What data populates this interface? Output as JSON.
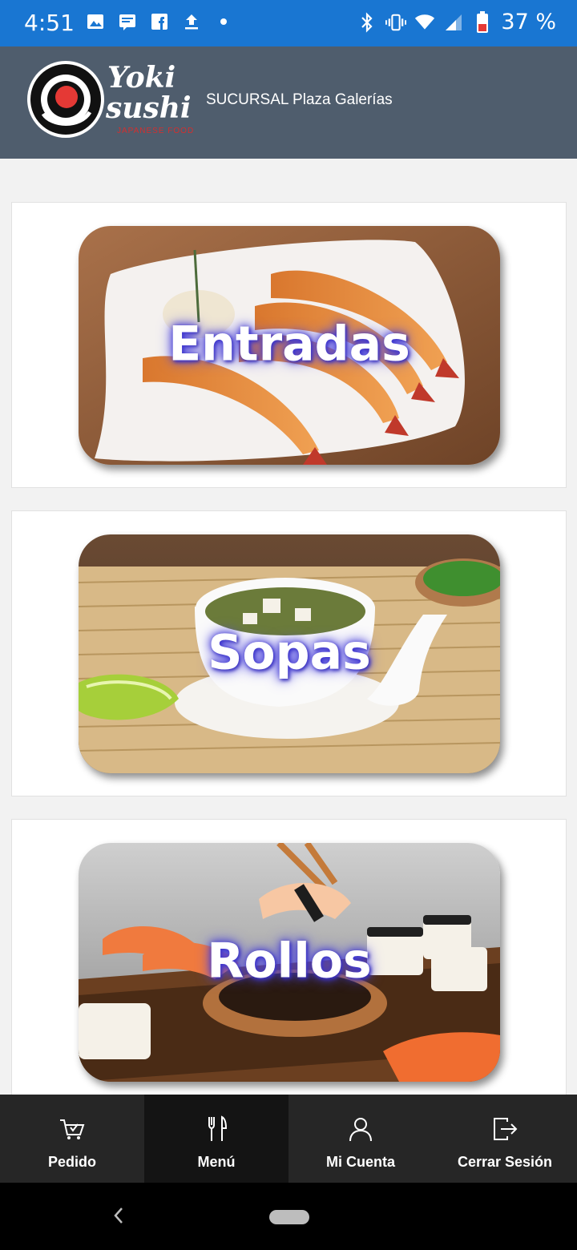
{
  "status_bar": {
    "time": "4:51",
    "battery": "37 %",
    "icons_left": [
      "image-icon",
      "message-icon",
      "facebook-icon",
      "upload-icon",
      "dot-icon"
    ],
    "icons_right": [
      "bluetooth-icon",
      "vibrate-icon",
      "wifi-icon",
      "signal-icon",
      "battery-icon"
    ]
  },
  "header": {
    "logo_line1": "Yoki",
    "logo_line2": "sushi",
    "logo_tagline": "JAPANESE FOOD",
    "branch": "SUCURSAL Plaza Galerías"
  },
  "categories": [
    {
      "label": "Entradas",
      "image": "fried-shrimp-photo"
    },
    {
      "label": "Sopas",
      "image": "miso-soup-photo"
    },
    {
      "label": "Rollos",
      "image": "sushi-rolls-photo"
    }
  ],
  "bottom_nav": {
    "items": [
      {
        "label": "Pedido",
        "icon": "cart-icon"
      },
      {
        "label": "Menú",
        "icon": "utensils-icon",
        "active": true
      },
      {
        "label": "Mi Cuenta",
        "icon": "user-icon"
      },
      {
        "label": "Cerrar Sesión",
        "icon": "logout-icon"
      }
    ]
  },
  "colors": {
    "status_bar": "#1976d2",
    "header": "#4f5d6d",
    "nav_bg": "#262626",
    "nav_active": "#141414",
    "label_glow": "#3d35d0"
  }
}
